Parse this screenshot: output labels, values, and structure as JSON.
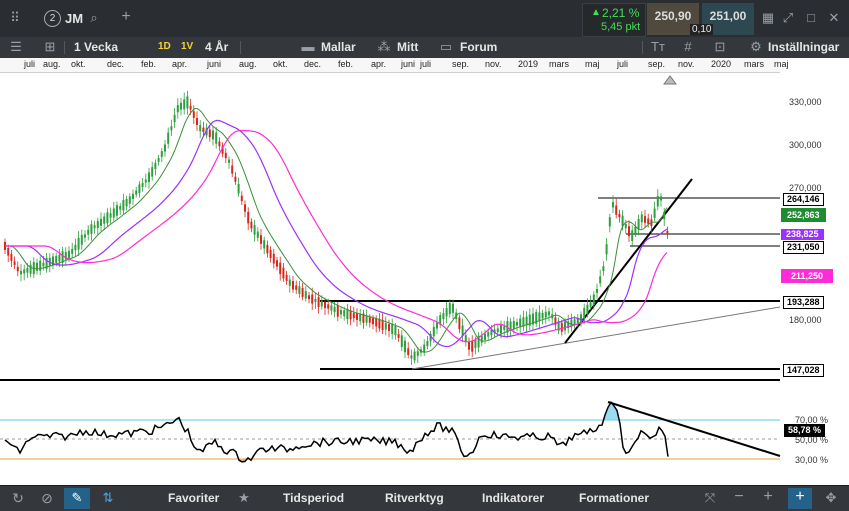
{
  "header": {
    "badge_number": "2",
    "ticker": "JM",
    "change_pct": "2,21 %",
    "change_pts": "5,45 pkt",
    "bid": "250,90",
    "ask": "251,00",
    "spread": "0,10"
  },
  "toolbar": {
    "period": "1 Vecka",
    "range_1d": "1D",
    "range_1v": "1V",
    "range_4ar": "4 År",
    "templates": "Mallar",
    "mine": "Mitt",
    "forum": "Forum",
    "settings": "Inställningar"
  },
  "time_axis": {
    "labels": [
      "juli",
      "aug.",
      "okt.",
      "dec.",
      "feb.",
      "apr.",
      "juni",
      "aug.",
      "okt.",
      "dec.",
      "feb.",
      "apr.",
      "juni",
      "juli",
      "sep.",
      "nov.",
      "2019",
      "mars",
      "maj",
      "juli",
      "sep.",
      "nov.",
      "2020",
      "mars",
      "maj"
    ]
  },
  "price_axis": {
    "labels": [
      "330,000",
      "300,000",
      "270,000",
      "180,000"
    ]
  },
  "price_tags": {
    "resistance_high": "264,146",
    "last_price": "252,863",
    "ma_purple": "238,825",
    "support_mid": "231,050",
    "ma_pink": "211,250",
    "support_193": "193,288",
    "support_147": "147,028"
  },
  "rsi": {
    "value": "58,78 %",
    "upper_label": "70,00 %",
    "mid_label": "50,00 %",
    "lower_label": "30,00 %"
  },
  "bottom": {
    "favorites": "Favoriter",
    "period": "Tidsperiod",
    "tool": "Ritverktyg",
    "indicators": "Indikatorer",
    "formations": "Formationer"
  },
  "colors": {
    "up": "#2e9e3e",
    "down": "#d9261c",
    "ma_short": "#3a8f3a",
    "ma_mid": "#9b30ff",
    "ma_long": "#ff2bd6",
    "rsi_upper": "#5fc8e8",
    "rsi_lower": "#e8a030",
    "change": "#3fe04f",
    "last_tag": "#1f8c2f",
    "purple_tag": "#9b30ff",
    "pink_tag": "#ff2bd6"
  },
  "chart_data": {
    "type": "candlestick",
    "y_axis_ticks": [
      330,
      300,
      270,
      180
    ],
    "horizontal_levels": [
      264.146,
      231.05,
      193.288,
      147.028
    ],
    "last_price": 252.863,
    "ma_values": [
      238.825,
      211.25
    ],
    "rsi_last": 58.78,
    "rsi_levels": [
      70,
      50,
      30
    ]
  }
}
